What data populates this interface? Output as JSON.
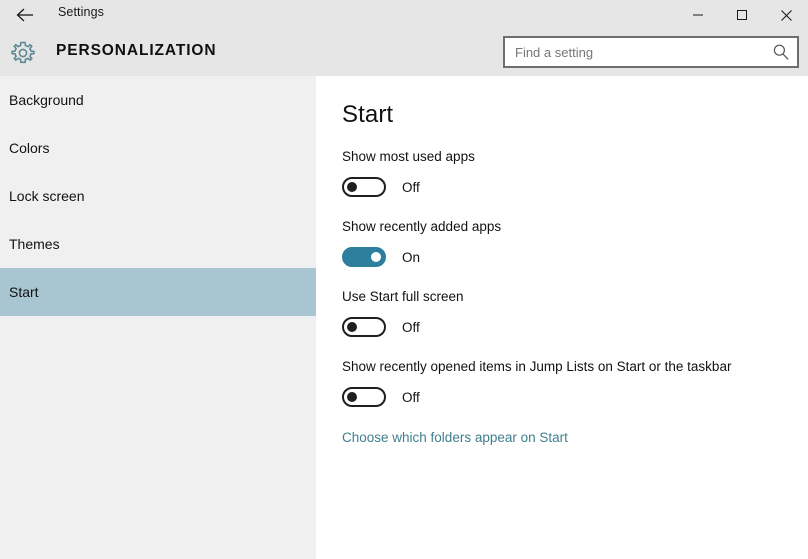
{
  "window": {
    "back_icon": "back-arrow-icon",
    "title": "Settings",
    "minimize_label": "—",
    "maximize_label": "□",
    "close_label": "✕"
  },
  "header": {
    "icon": "gear-icon",
    "category": "PERSONALIZATION"
  },
  "search": {
    "value": "",
    "placeholder": "Find a setting",
    "icon": "search-icon"
  },
  "sidebar": {
    "items": [
      {
        "label": "Background",
        "selected": false
      },
      {
        "label": "Colors",
        "selected": false
      },
      {
        "label": "Lock screen",
        "selected": false
      },
      {
        "label": "Themes",
        "selected": false
      },
      {
        "label": "Start",
        "selected": true
      }
    ],
    "selected_bg": "#a7c6d1",
    "bg": "#f0f0f0"
  },
  "main": {
    "title": "Start",
    "settings": [
      {
        "label": "Show most used apps",
        "state": "Off",
        "on": false
      },
      {
        "label": "Show recently added apps",
        "state": "On",
        "on": true
      },
      {
        "label": "Use Start full screen",
        "state": "Off",
        "on": false
      },
      {
        "label": "Show recently opened items in Jump Lists on Start or the taskbar",
        "state": "Off",
        "on": false
      }
    ],
    "link": "Choose which folders appear on Start",
    "link_color": "#3f7f8f",
    "accent_on_color": "#2d7f9d"
  }
}
